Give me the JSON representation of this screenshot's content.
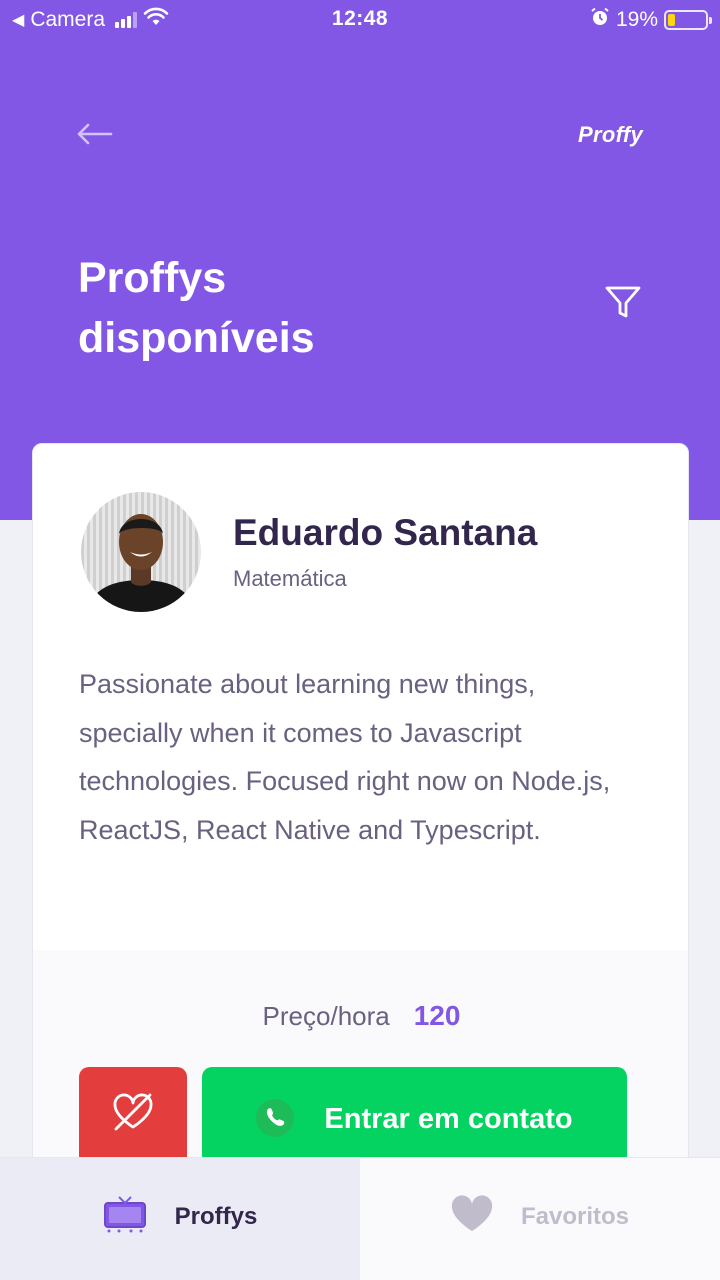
{
  "status_bar": {
    "back_app": "Camera",
    "time": "12:48",
    "battery": "19%",
    "battery_level": 0.19
  },
  "header": {
    "back_icon": "arrow-left-icon",
    "logo": "Proffy",
    "title_line1": "Proffys",
    "title_line2": "disponíveis",
    "filter_icon": "filter-icon"
  },
  "teacher": {
    "name": "Eduardo Santana",
    "subject": "Matemática",
    "bio": "Passionate about learning new things, specially when it comes to Javascript technologies. Focused right now on Node.js, ReactJS, React Native and Typescript.",
    "price_label": "Preço/hora",
    "price_value": "120",
    "favorite_icon": "heart-outline-icon",
    "contact_label": "Entrar em contato",
    "contact_icon": "whatsapp-icon"
  },
  "tabs": [
    {
      "label": "Proffys",
      "icon": "tv-icon",
      "active": true
    },
    {
      "label": "Favoritos",
      "icon": "heart-icon",
      "active": false
    }
  ],
  "colors": {
    "primary": "#8257E5",
    "secondary": "#04D361",
    "danger": "#E33D3D",
    "title": "#32264D",
    "text": "#6A6180",
    "muted": "#C1BCCC"
  }
}
